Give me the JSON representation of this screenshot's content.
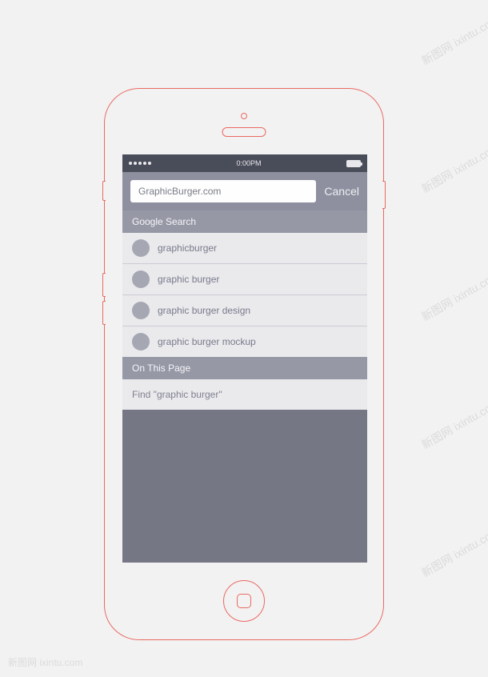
{
  "watermark": "新图网 ixintu.com",
  "status_bar": {
    "time": "0:00PM"
  },
  "search_header": {
    "input_value": "GraphicBurger.com",
    "cancel_label": "Cancel"
  },
  "sections": {
    "google_search_label": "Google Search",
    "on_this_page_label": "On This Page"
  },
  "suggestions": [
    "graphicburger",
    "graphic burger",
    "graphic burger design",
    "graphic burger mockup"
  ],
  "find_on_page": "Find \"graphic burger\""
}
